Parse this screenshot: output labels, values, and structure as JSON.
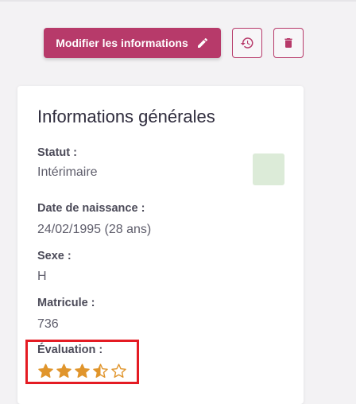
{
  "toolbar": {
    "edit_label": "Modifier les informations"
  },
  "card": {
    "title": "Informations générales",
    "fields": [
      {
        "label": "Statut :",
        "value": "Intérimaire"
      },
      {
        "label": "Date de naissance :",
        "value": "24/02/1995 (28 ans)"
      },
      {
        "label": "Sexe :",
        "value": "H"
      },
      {
        "label": "Matricule :",
        "value": "736"
      }
    ],
    "evaluation": {
      "label": "Évaluation :",
      "rating": 3.5,
      "max": 5
    },
    "status_color": "#dcebd8"
  },
  "colors": {
    "accent": "#b73a6a",
    "star": "#e0952c",
    "highlight": "#e41b23"
  },
  "icons": {
    "edit": "pencil-icon",
    "history": "history-icon",
    "delete": "trash-icon",
    "rating": "star-icon"
  }
}
